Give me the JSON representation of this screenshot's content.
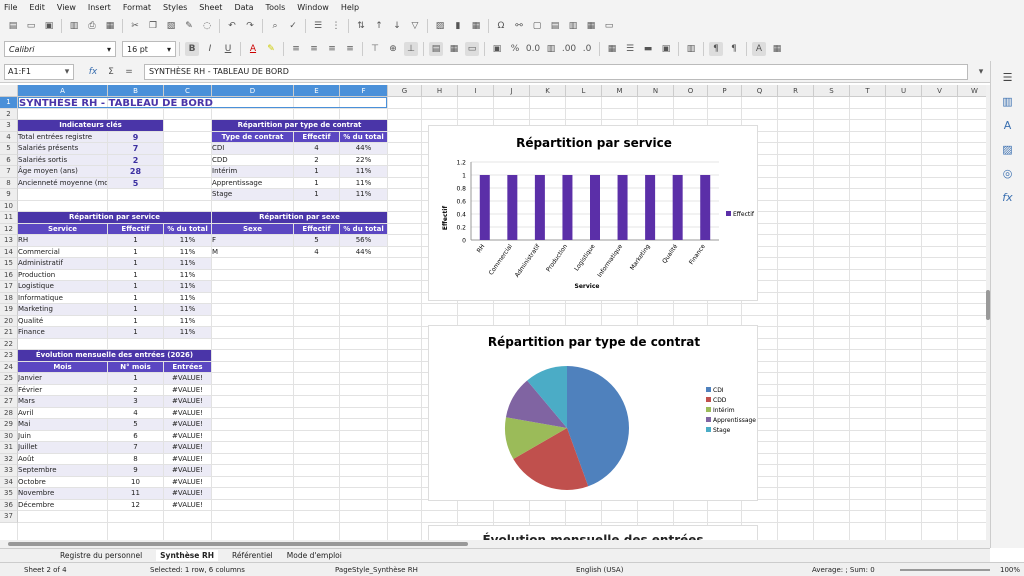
{
  "menu": [
    "File",
    "Edit",
    "View",
    "Insert",
    "Format",
    "Styles",
    "Sheet",
    "Data",
    "Tools",
    "Window",
    "Help"
  ],
  "font_name": "Calibri",
  "font_size": "16 pt",
  "name_box": "A1:F1",
  "formula_text": "SYNTHÈSE RH - TABLEAU DE BORD",
  "title": "SYNTHÈSE RH - TABLEAU DE BORD",
  "columns": [
    "A",
    "B",
    "C",
    "D",
    "E",
    "F",
    "G",
    "H",
    "I",
    "J",
    "K",
    "L",
    "M",
    "N",
    "O",
    "P",
    "Q",
    "R",
    "S",
    "T",
    "U",
    "V",
    "W"
  ],
  "rows": [
    "1",
    "2",
    "3",
    "4",
    "5",
    "6",
    "7",
    "8",
    "9",
    "10",
    "11",
    "12",
    "13",
    "14",
    "15",
    "16",
    "17",
    "18",
    "19",
    "20",
    "21",
    "22",
    "23",
    "24",
    "25",
    "26",
    "27",
    "28",
    "29",
    "30",
    "31",
    "32",
    "33",
    "34",
    "35",
    "36",
    "37"
  ],
  "kpi": {
    "header": "Indicateurs clés",
    "items": [
      {
        "label": "Total entrées registre",
        "value": "9"
      },
      {
        "label": "Salariés présents",
        "value": "7"
      },
      {
        "label": "Salariés sortis",
        "value": "2"
      },
      {
        "label": "Âge moyen (ans)",
        "value": "28"
      },
      {
        "label": "Ancienneté moyenne (mois)",
        "value": "5"
      }
    ]
  },
  "contrat": {
    "header": "Répartition par type de contrat",
    "cols": [
      "Type de contrat",
      "Effectif",
      "% du total"
    ],
    "rows": [
      [
        "CDI",
        "4",
        "44%"
      ],
      [
        "CDD",
        "2",
        "22%"
      ],
      [
        "Intérim",
        "1",
        "11%"
      ],
      [
        "Apprentissage",
        "1",
        "11%"
      ],
      [
        "Stage",
        "1",
        "11%"
      ]
    ]
  },
  "service": {
    "header": "Répartition par service",
    "cols": [
      "Service",
      "Effectif",
      "% du total"
    ],
    "rows": [
      [
        "RH",
        "1",
        "11%"
      ],
      [
        "Commercial",
        "1",
        "11%"
      ],
      [
        "Administratif",
        "1",
        "11%"
      ],
      [
        "Production",
        "1",
        "11%"
      ],
      [
        "Logistique",
        "1",
        "11%"
      ],
      [
        "Informatique",
        "1",
        "11%"
      ],
      [
        "Marketing",
        "1",
        "11%"
      ],
      [
        "Qualité",
        "1",
        "11%"
      ],
      [
        "Finance",
        "1",
        "11%"
      ]
    ]
  },
  "sexe": {
    "header": "Répartition par sexe",
    "cols": [
      "Sexe",
      "Effectif",
      "% du total"
    ],
    "rows": [
      [
        "F",
        "5",
        "56%"
      ],
      [
        "M",
        "4",
        "44%"
      ]
    ]
  },
  "evolution": {
    "header": "Évolution mensuelle des entrées (2026)",
    "cols": [
      "Mois",
      "N° mois",
      "Entrées"
    ],
    "rows": [
      [
        "Janvier",
        "1",
        "#VALUE!"
      ],
      [
        "Février",
        "2",
        "#VALUE!"
      ],
      [
        "Mars",
        "3",
        "#VALUE!"
      ],
      [
        "Avril",
        "4",
        "#VALUE!"
      ],
      [
        "Mai",
        "5",
        "#VALUE!"
      ],
      [
        "Juin",
        "6",
        "#VALUE!"
      ],
      [
        "Juillet",
        "7",
        "#VALUE!"
      ],
      [
        "Août",
        "8",
        "#VALUE!"
      ],
      [
        "Septembre",
        "9",
        "#VALUE!"
      ],
      [
        "Octobre",
        "10",
        "#VALUE!"
      ],
      [
        "Novembre",
        "11",
        "#VALUE!"
      ],
      [
        "Décembre",
        "12",
        "#VALUE!"
      ]
    ]
  },
  "chart_data": [
    {
      "type": "bar",
      "title": "Répartition par service",
      "xlabel": "Service",
      "ylabel": "Effectif",
      "categories": [
        "RH",
        "Commercial",
        "Administratif",
        "Production",
        "Logistique",
        "Informatique",
        "Marketing",
        "Qualité",
        "Finance"
      ],
      "series": [
        {
          "name": "Effectif",
          "values": [
            1,
            1,
            1,
            1,
            1,
            1,
            1,
            1,
            1
          ]
        }
      ],
      "ylim": [
        0,
        1.2
      ],
      "yticks": [
        "0",
        "0.2",
        "0.4",
        "0.6",
        "0.8",
        "1",
        "1.2"
      ],
      "legend": "right",
      "color": "#5b2fa8"
    },
    {
      "type": "pie",
      "title": "Répartition par type de contrat",
      "categories": [
        "CDI",
        "CDD",
        "Intérim",
        "Apprentissage",
        "Stage"
      ],
      "values": [
        4,
        2,
        1,
        1,
        1
      ],
      "colors": [
        "#4f81bd",
        "#c0504d",
        "#9bbb59",
        "#8064a2",
        "#4bacc6"
      ],
      "legend": "right"
    }
  ],
  "chart3_title": "Évolution mensuelle des entrées",
  "tabs": [
    "Registre du personnel",
    "Synthèse RH",
    "Référentiel",
    "Mode d'emploi"
  ],
  "status": {
    "sheet": "Sheet 2 of 4",
    "selection": "Selected: 1 row, 6 columns",
    "pagestyle": "PageStyle_Synthèse RH",
    "lang": "English (USA)",
    "sum": "Average: ; Sum: 0",
    "zoom": "100%"
  }
}
